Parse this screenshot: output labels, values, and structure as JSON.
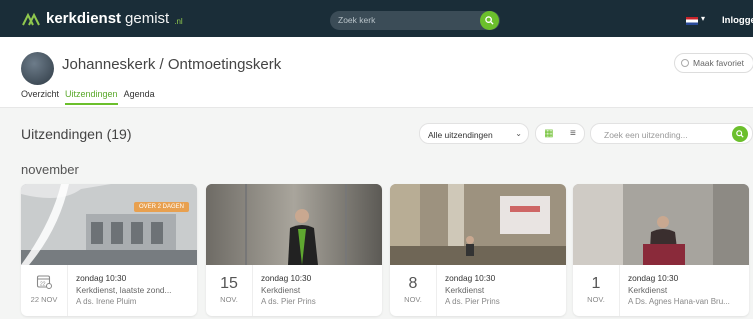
{
  "topbar": {
    "logo_bold": "kerkdienst",
    "logo_rest": "gemist",
    "logo_tld": ".nl",
    "search_placeholder": "Zoek kerk",
    "login": "Inlogge",
    "search_icon": "search-icon",
    "flag": "nl-flag-icon"
  },
  "header": {
    "church_name": "Johanneskerk / Ontmoetingskerk",
    "fav_label": "Maak favoriet",
    "tabs": [
      "Overzicht",
      "Uitzendingen",
      "Agenda"
    ],
    "active_tab": "Uitzendingen"
  },
  "main": {
    "title": "Uitzendingen (19)",
    "filter_value": "Alle uitzendingen",
    "search_placeholder": "Zoek een uitzending...",
    "month": "november"
  },
  "cards": [
    {
      "day": "",
      "month": "22 NOV",
      "badge": "OVER 2 DAGEN",
      "time": "zondag 10:30",
      "subject": "Kerkdienst, laatste zond...",
      "person": "A ds. Irene Pluim"
    },
    {
      "day": "15",
      "month": "NOV.",
      "time": "zondag 10:30",
      "subject": "Kerkdienst",
      "person": "A ds. Pier Prins"
    },
    {
      "day": "8",
      "month": "NOV.",
      "time": "zondag 10:30",
      "subject": "Kerkdienst",
      "person": "A ds. Pier Prins"
    },
    {
      "day": "1",
      "month": "NOV.",
      "time": "zondag 10:30",
      "subject": "Kerkdienst",
      "person": "A Ds. Agnes Hana-van Bru..."
    }
  ],
  "colors": {
    "accent": "#6bbf2c",
    "topbar": "#1a2d38",
    "badge": "#e8a04f"
  }
}
